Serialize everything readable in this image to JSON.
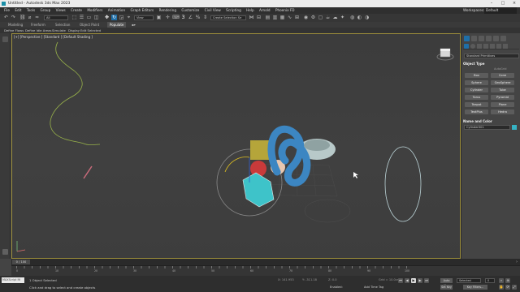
{
  "window": {
    "title": "Untitled - Autodesk 3ds Max 2023"
  },
  "menus": [
    "File",
    "Edit",
    "Tools",
    "Group",
    "Views",
    "Create",
    "Modifiers",
    "Animation",
    "Graph Editors",
    "Rendering",
    "Customize",
    "Civil View",
    "Scripting",
    "Help",
    "Arnold",
    "Phoenix FD"
  ],
  "workspace": {
    "label": "Workspaces:",
    "value": "Default"
  },
  "toolbar": {
    "selection_filter": "All",
    "view_dropdown": "View",
    "named_selection": "Create Selection Se"
  },
  "ribbon": {
    "tabs": [
      "Modeling",
      "Freeform",
      "Selection",
      "Object Paint",
      "Populate"
    ],
    "row": [
      "Define Flows",
      "Define Idle Areas",
      "Simulate",
      "Display",
      "Edit Selected"
    ]
  },
  "viewport": {
    "label": "[+] [Perspective ] [Standard ] [Default Shading ]"
  },
  "command_panel": {
    "dropdown": "Standard Primitives",
    "object_type_header": "Object Type",
    "autogrid": "AutoGrid",
    "buttons": [
      "Box",
      "Cone",
      "Sphere",
      "GeoSphere",
      "Cylinder",
      "Tube",
      "Torus",
      "Pyramid",
      "Teapot",
      "Plane",
      "TextPlus",
      "Hedra"
    ],
    "name_color_header": "Name and Color",
    "name_value": "Cylinder001",
    "swatch_color": "#36b3c4"
  },
  "timeline": {
    "frame": "0 / 100",
    "ticks": [
      "0",
      "10",
      "20",
      "30",
      "40",
      "50",
      "60",
      "70",
      "80",
      "90",
      "100"
    ]
  },
  "status": {
    "script_field": "MAXScript Mi",
    "selected": "1 Object Selected",
    "prompt": "Click and drag to select and create objects",
    "x": "X: 141.953",
    "y": "Y: -311.18",
    "z": "Z: 0.0",
    "grid": "Grid = 10.0cm",
    "enabled": "Enabled:",
    "add_time_tag": "Add Time Tag",
    "auto_key": "Auto Key",
    "set_key": "Set Key",
    "key_mode": "Selected",
    "key_filters": "Key Filters...",
    "frame_field": "0"
  }
}
